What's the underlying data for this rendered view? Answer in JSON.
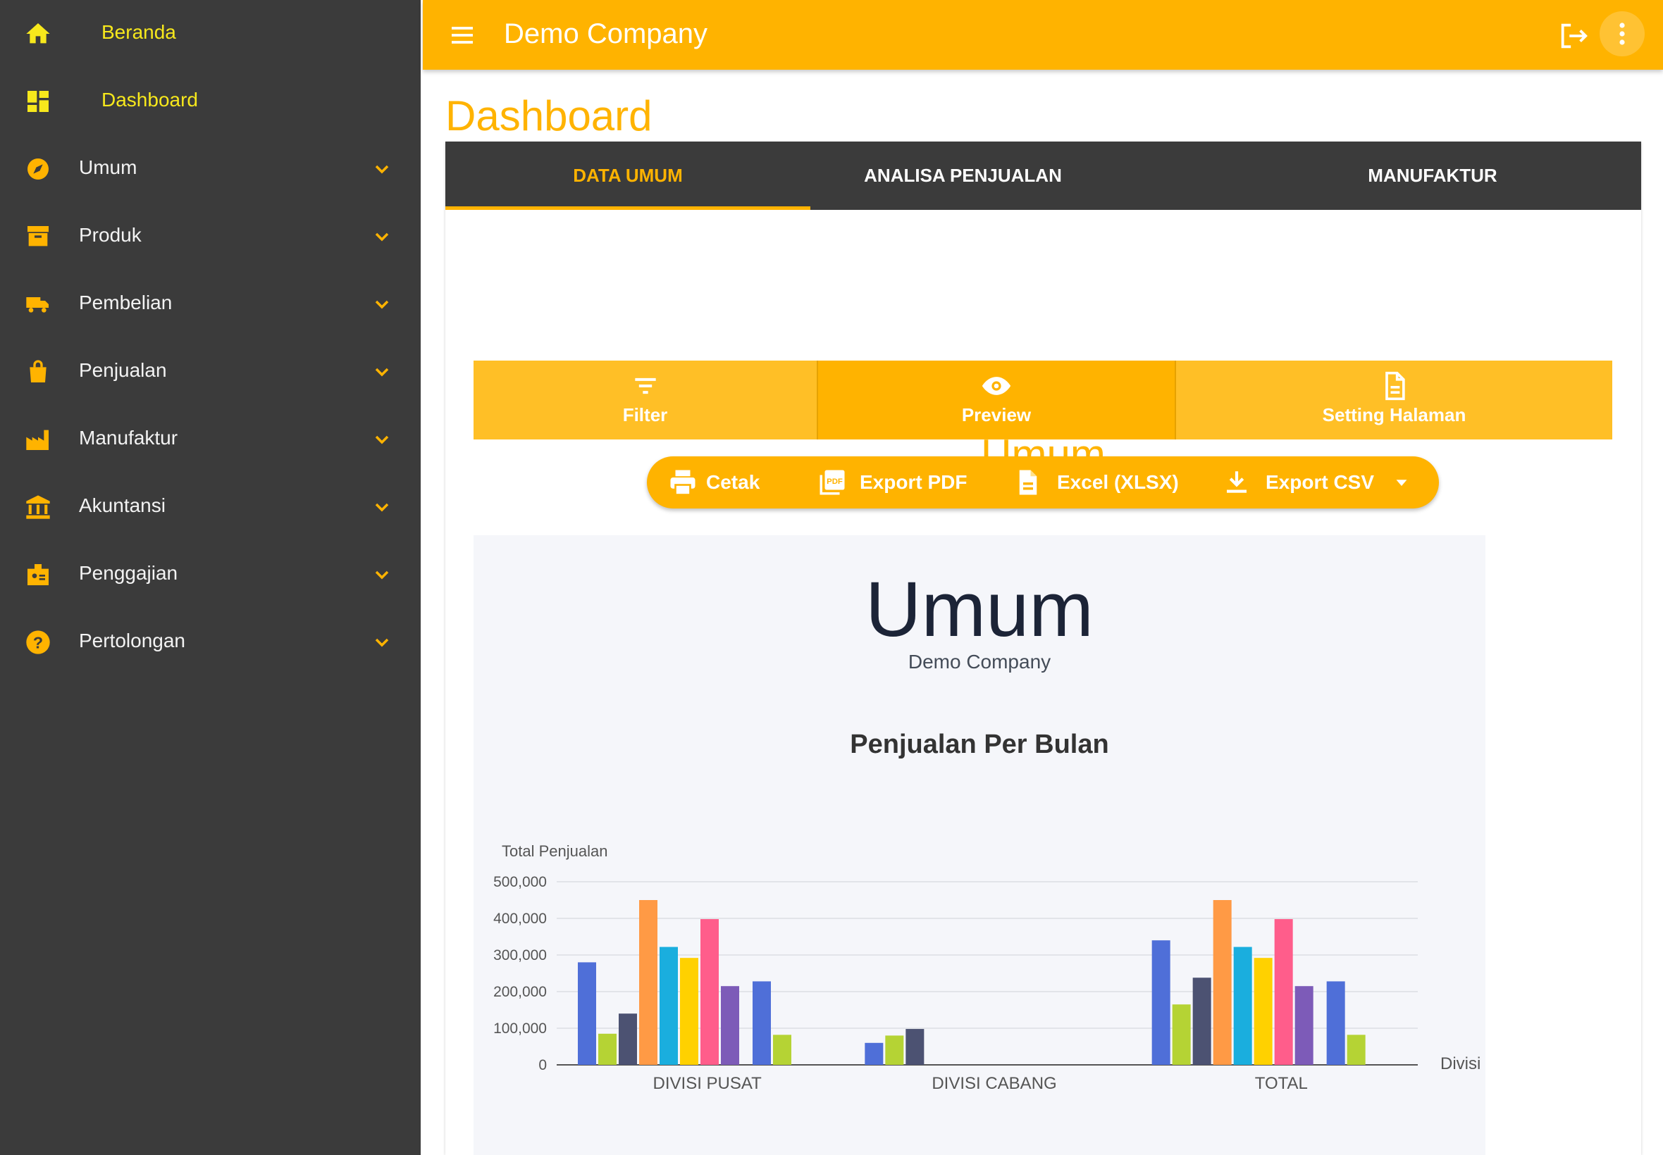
{
  "sidebar": {
    "items": [
      {
        "label": "Beranda",
        "icon": "home-icon",
        "top": true
      },
      {
        "label": "Dashboard",
        "icon": "dashboard-icon",
        "top": true
      },
      {
        "label": "Umum",
        "icon": "compass-icon"
      },
      {
        "label": "Produk",
        "icon": "archive-icon"
      },
      {
        "label": "Pembelian",
        "icon": "truck-icon"
      },
      {
        "label": "Penjualan",
        "icon": "shopping-bag-icon"
      },
      {
        "label": "Manufaktur",
        "icon": "factory-icon"
      },
      {
        "label": "Akuntansi",
        "icon": "bank-icon"
      },
      {
        "label": "Penggajian",
        "icon": "badge-icon"
      },
      {
        "label": "Pertolongan",
        "icon": "help-icon"
      }
    ]
  },
  "header": {
    "company": "Demo Company"
  },
  "page": {
    "title": "Dashboard"
  },
  "tabs": [
    "DATA UMUM",
    "ANALISA PENJUALAN",
    "MANUFAKTUR"
  ],
  "section": {
    "title": "Umum"
  },
  "toolbar": {
    "filter": "Filter",
    "preview": "Preview",
    "setting": "Setting Halaman"
  },
  "export": {
    "print": "Cetak",
    "pdf": "Export PDF",
    "excel": "Excel (XLSX)",
    "csv": "Export CSV"
  },
  "report": {
    "title": "Umum",
    "subtitle": "Demo Company"
  },
  "colors": {
    "accent": "#ffb300",
    "sidebar_bg": "#3b3b3b",
    "sidebar_active_text": "#f7e81c"
  },
  "chart_data": {
    "type": "bar",
    "title": "Penjualan Per Bulan",
    "ylabel": "Total Penjualan",
    "xlabel": "Divisi",
    "ylim": [
      0,
      500000
    ],
    "yticks": [
      "0",
      "100,000",
      "200,000",
      "300,000",
      "400,000",
      "500,000"
    ],
    "categories": [
      "DIVISI PUSAT",
      "DIVISI CABANG",
      "TOTAL"
    ],
    "series_colors": [
      "#4f6fd8",
      "#b5d334",
      "#4c5272",
      "#ff9a45",
      "#1aaede",
      "#ffd100",
      "#ff5d8b",
      "#7d5bb8",
      "#4f6fd8",
      "#b5d334"
    ],
    "series": [
      {
        "values": [
          280000,
          60000,
          340000
        ]
      },
      {
        "values": [
          85000,
          80000,
          165000
        ]
      },
      {
        "values": [
          140000,
          98000,
          238000
        ]
      },
      {
        "values": [
          450000,
          0,
          450000
        ]
      },
      {
        "values": [
          322000,
          0,
          322000
        ]
      },
      {
        "values": [
          292000,
          0,
          292000
        ]
      },
      {
        "values": [
          398000,
          0,
          398000
        ]
      },
      {
        "values": [
          215000,
          0,
          215000
        ]
      },
      {
        "values": [
          228000,
          0,
          228000
        ]
      },
      {
        "values": [
          82000,
          0,
          82000
        ]
      }
    ]
  }
}
